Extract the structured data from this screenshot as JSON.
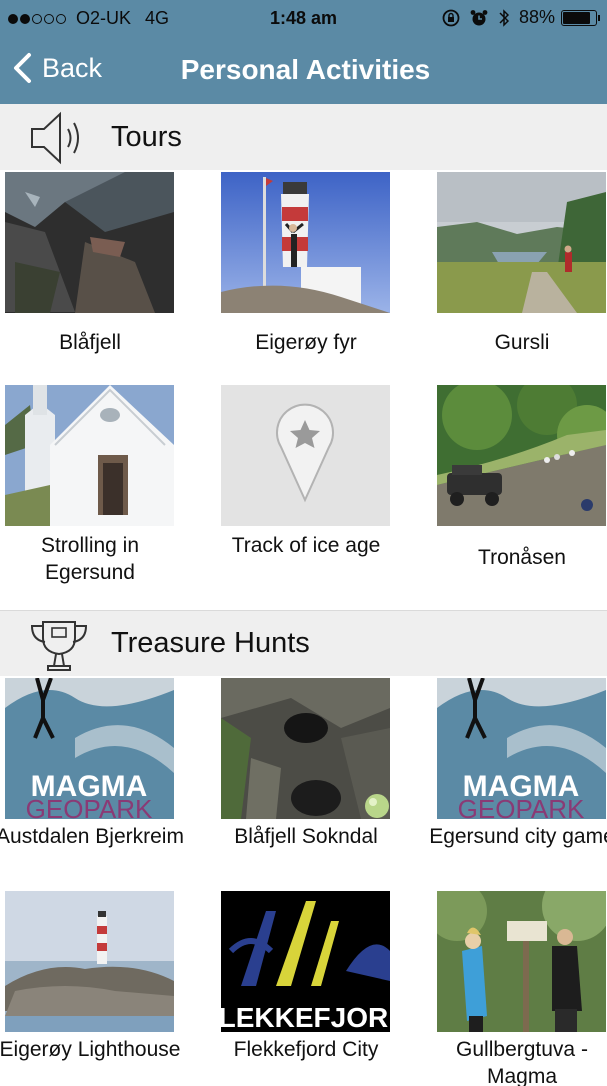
{
  "status": {
    "carrier": "O2-UK",
    "network": "4G",
    "time": "1:48 am",
    "battery_percent": "88%",
    "battery_level": 0.88,
    "signal_bars_filled": 2,
    "signal_bars_total": 5
  },
  "nav": {
    "back_label": "Back",
    "title": "Personal Activities"
  },
  "sections": {
    "tours": {
      "title": "Tours",
      "icon": "speaker-icon",
      "items": [
        {
          "caption": "Blåfjell"
        },
        {
          "caption": "Eigerøy fyr"
        },
        {
          "caption": "Gursli"
        },
        {
          "caption": "Strolling in Egersund"
        },
        {
          "caption": "Track of ice age"
        },
        {
          "caption": "Tronåsen"
        }
      ]
    },
    "hunts": {
      "title": "Treasure Hunts",
      "icon": "trophy-icon",
      "items": [
        {
          "caption": "Austdalen Bjerkreim",
          "logo_line1": "MAGMA",
          "logo_line2": "GEOPARK"
        },
        {
          "caption": "Blåfjell Sokndal"
        },
        {
          "caption": "Egersund city game",
          "logo_line1": "MAGMA",
          "logo_line2": "GEOPARK"
        },
        {
          "caption": "Eigerøy Lighthouse"
        },
        {
          "caption": "Flekkefjord City",
          "logo_line1": "FLEKKEFJORD"
        },
        {
          "caption": "Gullbergtuva - Magma"
        }
      ]
    }
  },
  "colors": {
    "bar": "#5b8aa5",
    "section_bg": "#efefef"
  }
}
